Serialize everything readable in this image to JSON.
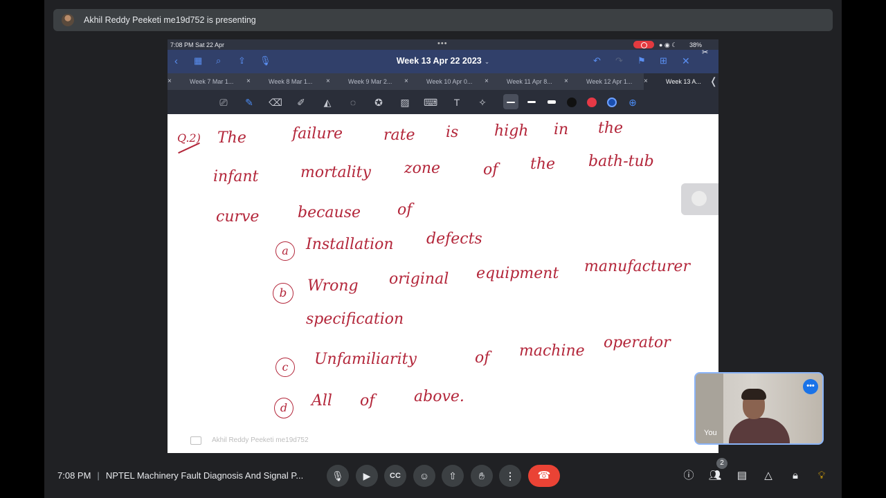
{
  "banner": {
    "presenting_text": "Akhil Reddy Peeketi me19d752 is presenting"
  },
  "ipad_status": {
    "time_date": "7:08 PM   Sat 22 Apr",
    "battery": "38%"
  },
  "document": {
    "title": "Week 13 Apr 22 2023"
  },
  "tabs": [
    {
      "label": "Week 7 Mar 1..."
    },
    {
      "label": "Week 8 Mar 1..."
    },
    {
      "label": "Week 9 Mar 2..."
    },
    {
      "label": "Week 10 Apr 0..."
    },
    {
      "label": "Week 11 Apr 8..."
    },
    {
      "label": "Week 12 Apr 1..."
    },
    {
      "label": "Week 13 A..."
    }
  ],
  "ink_colors": {
    "black": "#111111",
    "red": "#e63946",
    "blue": "#1a4fb0"
  },
  "handwriting": {
    "q_label": "Q.2)",
    "line1": [
      "The",
      "failure",
      "rate",
      "is",
      "high",
      "in",
      "the"
    ],
    "line2": [
      "infant",
      "mortality",
      "zone",
      "of",
      "the",
      "bath-tub"
    ],
    "line3": [
      "curve",
      "because",
      "of"
    ],
    "opt_a_marker": "a",
    "opt_a": [
      "Installation",
      "defects"
    ],
    "opt_b_marker": "b",
    "opt_b": [
      "Wrong",
      "original",
      "equipment",
      "manufacturer"
    ],
    "opt_b2": "specification",
    "opt_c_marker": "c",
    "opt_c": [
      "Unfamiliarity",
      "of",
      "machine",
      "operator"
    ],
    "opt_d_marker": "d",
    "opt_d": [
      "All",
      "of",
      "above."
    ]
  },
  "shared_footer": "Akhil Reddy Peeketi me19d752",
  "self_tile": {
    "label": "You"
  },
  "meeting": {
    "time": "7:08 PM",
    "title": "NPTEL Machinery Fault Diagnosis And Signal P..."
  },
  "participants_count": "2",
  "brand_colors": {
    "end_call": "#ea4335",
    "accent": "#8ab4f8"
  }
}
